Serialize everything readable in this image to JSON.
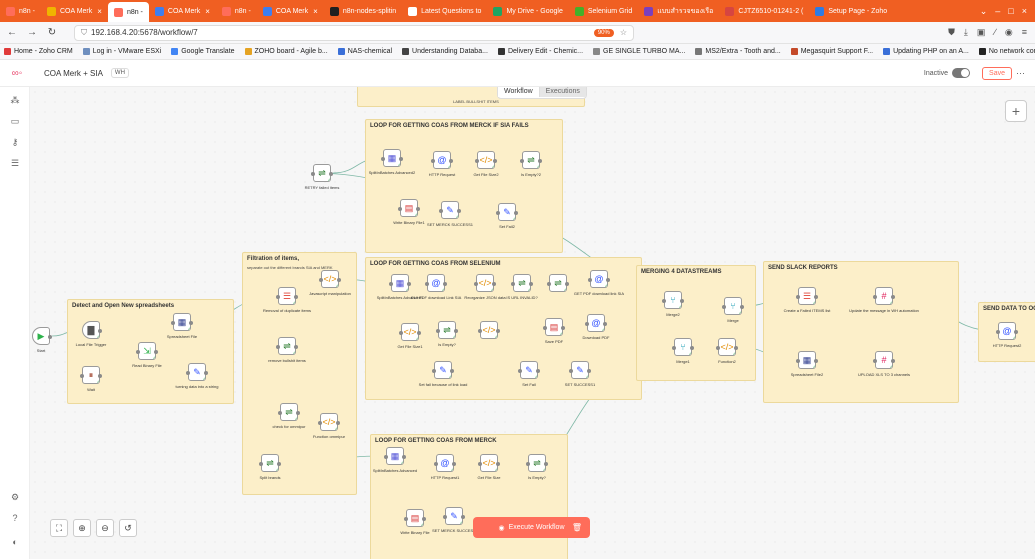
{
  "browser": {
    "tabs": [
      {
        "label": "n8n -",
        "color": "#ff6d5a"
      },
      {
        "label": "COA Merk",
        "color": "#f0b400"
      },
      {
        "label": "n8n -",
        "color": "#ff6d5a",
        "active": true
      },
      {
        "label": "COA Merk",
        "color": "#3d7ef0"
      },
      {
        "label": "n8n -",
        "color": "#ff6d5a"
      },
      {
        "label": "COA Merk",
        "color": "#3d7ef0"
      },
      {
        "label": "n8n-nodes-splitin",
        "color": "#202020"
      },
      {
        "label": "Latest Questions to",
        "color": "#f05f22"
      },
      {
        "label": "My Drive - Google",
        "color": "#1fa463"
      },
      {
        "label": "Selenium Grid",
        "color": "#43b02a"
      },
      {
        "label": "แบบสำรวจของเรือ",
        "color": "#7b3fbe"
      },
      {
        "label": "CJTZ6510-01241-2 (",
        "color": "#d64541"
      },
      {
        "label": "Setup Page - Zoho",
        "color": "#2c7be5"
      }
    ],
    "url": "192.168.4.20:5678/workflow/7",
    "zoom": "90%",
    "bookmarks": [
      {
        "label": "Home - Zoho CRM",
        "color": "#e03a3a"
      },
      {
        "label": "Log in - VMware ESXi",
        "color": "#6f8fbf"
      },
      {
        "label": "Google Translate",
        "color": "#4285f4"
      },
      {
        "label": "ZOHO board - Agile b...",
        "color": "#e5a323"
      },
      {
        "label": "NAS-chemical",
        "color": "#3a6fd8"
      },
      {
        "label": "Understanding Databa...",
        "color": "#444444"
      },
      {
        "label": "Delivery Edit - Chemic...",
        "color": "#333333"
      },
      {
        "label": "GE SINGLE TURBO MA...",
        "color": "#888888"
      },
      {
        "label": "MS2/Extra - Tooth and...",
        "color": "#777777"
      },
      {
        "label": "Megasquirt Support F...",
        "color": "#c44a2a"
      },
      {
        "label": "Updating PHP on an A...",
        "color": "#3a6fd8"
      },
      {
        "label": "No network connectio...",
        "color": "#222222"
      }
    ]
  },
  "app": {
    "workflow_name": "COA Merk + SIA",
    "tag": "WH",
    "status_label": "Inactive",
    "save_label": "Save",
    "mode_tabs": [
      "Workflow",
      "Executions"
    ],
    "execute_label": "Execute Workflow"
  },
  "notes": [
    {
      "title": "LOOP FOR GETTING COAS FROM MERCK IF SIA FAILS",
      "sub": ""
    },
    {
      "title": "Filtration of items,",
      "sub": "separate out the different brands SIA and MERK"
    },
    {
      "title": "LOOP FOR GETTING COAS FROM SELENIUM",
      "sub": ""
    },
    {
      "title": "MERGING 4 DATASTREAMS",
      "sub": ""
    },
    {
      "title": "SEND SLACK REPORTS",
      "sub": ""
    },
    {
      "title": "SEND DATA TO OCR",
      "sub": ""
    },
    {
      "title": "Detect and Open New spreadsheets",
      "sub": ""
    },
    {
      "title": "LOOP FOR GETTING COAS FROM MERCK",
      "sub": ""
    },
    {
      "title": "",
      "sub": "LABEL BULLSHIT ITEMS"
    }
  ],
  "nodes": [
    {
      "label": "Start",
      "icon": "▶",
      "color": "#2db24a"
    },
    {
      "label": "Local File Trigger",
      "icon": "▇",
      "color": "#555555"
    },
    {
      "label": "Spreadsheet File",
      "icon": "▦",
      "color": "#2b3a8c"
    },
    {
      "label": "Read Binary File",
      "icon": "⇲",
      "color": "#2db24a"
    },
    {
      "label": "Wait",
      "icon": "⏸",
      "color": "#a0442e"
    },
    {
      "label": "turning data into a string",
      "icon": "✎",
      "color": "#3151ff"
    },
    {
      "label": "RETRY failed items",
      "icon": "⇌",
      "color": "#2e7d32"
    },
    {
      "label": "SplitInBatches Advanced2",
      "icon": "▦",
      "color": "#4e4fd6"
    },
    {
      "label": "HTTP Request",
      "icon": "@",
      "color": "#3151ff"
    },
    {
      "label": "Get File Size2",
      "icon": "</>",
      "color": "#e08a00"
    },
    {
      "label": "Is Empty?2",
      "icon": "⇌",
      "color": "#2e7d32"
    },
    {
      "label": "Write Binary File1",
      "icon": "▤",
      "color": "#d62f2f"
    },
    {
      "label": "SET MERCK SUCCESS1",
      "icon": "✎",
      "color": "#3151ff"
    },
    {
      "label": "Set Fail2",
      "icon": "✎",
      "color": "#3151ff"
    },
    {
      "label": "Removal of duplicate items",
      "icon": "☰",
      "color": "#e0463a"
    },
    {
      "label": "Javascript manipulation",
      "icon": "</>",
      "color": "#e08a00"
    },
    {
      "label": "remove bullshit items",
      "icon": "⇌",
      "color": "#2e7d32"
    },
    {
      "label": "SplitInBatches Advanced1",
      "icon": "▦",
      "color": "#4e4fd6"
    },
    {
      "label": "GUI PDF download Link SIA",
      "icon": "@",
      "color": "#3151ff"
    },
    {
      "label": "Reorganize JSON data",
      "icon": "</>",
      "color": "#e08a00"
    },
    {
      "label": "IS URL INVALID?",
      "icon": "⇌",
      "color": "#2e7d32"
    },
    {
      "label": "",
      "icon": "⇌",
      "color": "#2e7d32"
    },
    {
      "label": "GET PDF download link SIA",
      "icon": "@",
      "color": "#3151ff"
    },
    {
      "label": "Get File Size1",
      "icon": "</>",
      "color": "#e08a00"
    },
    {
      "label": "Is Empty?",
      "icon": "⇌",
      "color": "#2e7d32"
    },
    {
      "label": "",
      "icon": "</>",
      "color": "#e08a00"
    },
    {
      "label": "Save PDF",
      "icon": "▤",
      "color": "#d62f2f"
    },
    {
      "label": "Download PDF",
      "icon": "@",
      "color": "#3151ff"
    },
    {
      "label": "Set fail because of link load",
      "icon": "✎",
      "color": "#3151ff"
    },
    {
      "label": "Set Fail",
      "icon": "✎",
      "color": "#3151ff"
    },
    {
      "label": "SET SUCCESS1",
      "icon": "✎",
      "color": "#3151ff"
    },
    {
      "label": "Merge2",
      "icon": "⑂",
      "color": "#1f9fb5"
    },
    {
      "label": "Merge",
      "icon": "⑂",
      "color": "#1f9fb5"
    },
    {
      "label": "Merge1",
      "icon": "⑂",
      "color": "#1f9fb5"
    },
    {
      "label": "Function2",
      "icon": "</>",
      "color": "#e08a00"
    },
    {
      "label": "Create a Failed ITEMS list",
      "icon": "☰",
      "color": "#e0463a"
    },
    {
      "label": "Update the message in WH automation",
      "icon": "#",
      "color": "#e01e5a"
    },
    {
      "label": "Spreadsheet File2",
      "icon": "▦",
      "color": "#2b3a8c"
    },
    {
      "label": "UPLOAD XLS TO 3 channels",
      "icon": "#",
      "color": "#e01e5a"
    },
    {
      "label": "HTTP Request2",
      "icon": "@",
      "color": "#3151ff"
    },
    {
      "label": "check for ommipur",
      "icon": "⇌",
      "color": "#2e7d32"
    },
    {
      "label": "Function ommipur",
      "icon": "</>",
      "color": "#e08a00"
    },
    {
      "label": "Split brands",
      "icon": "⇌",
      "color": "#2e7d32"
    },
    {
      "label": "SplitInBatches Advanced",
      "icon": "▦",
      "color": "#4e4fd6"
    },
    {
      "label": "HTTP Request1",
      "icon": "@",
      "color": "#3151ff"
    },
    {
      "label": "Get File Size",
      "icon": "</>",
      "color": "#e08a00"
    },
    {
      "label": "Is Empty?",
      "icon": "⇌",
      "color": "#2e7d32"
    },
    {
      "label": "Write Binary File",
      "icon": "▤",
      "color": "#d62f2f"
    },
    {
      "label": "SET MERCK SUCCESS",
      "icon": "✎",
      "color": "#3151ff"
    }
  ]
}
